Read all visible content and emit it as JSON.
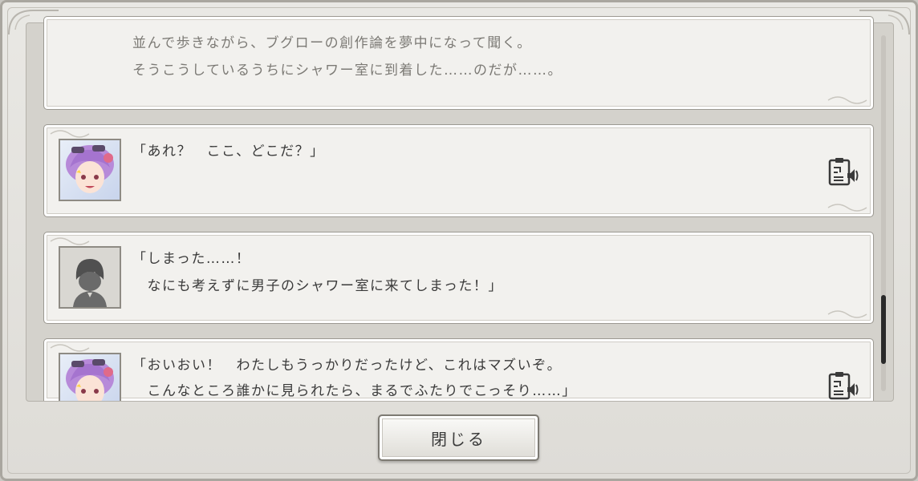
{
  "log": {
    "entries": [
      {
        "type": "narration",
        "lines": [
          "並んで歩きながら、ブグローの創作論を夢中になって聞く。",
          "そうこうしているうちにシャワー室に到着した……のだが……。"
        ]
      },
      {
        "type": "dialogue",
        "speaker_avatar": "purple-hair-girl-avatar",
        "lines": [
          "「あれ？　ここ、どこだ？」"
        ],
        "has_voice": true
      },
      {
        "type": "dialogue",
        "speaker_avatar": "player-silhouette-avatar",
        "lines": [
          "「しまった……！",
          "　なにも考えずに男子のシャワー室に来てしまった！」"
        ],
        "has_voice": false
      },
      {
        "type": "dialogue",
        "speaker_avatar": "purple-hair-girl-avatar",
        "lines": [
          "「おいおい！　わたしもうっかりだったけど、これはマズいぞ。",
          "　こんなところ誰かに見られたら、まるでふたりでこっそり……」"
        ],
        "has_voice": true
      }
    ]
  },
  "close_button": {
    "label": "閉じる"
  },
  "colors": {
    "panel_bg": "#f2f1ee",
    "narration_text": "#7c7a75",
    "dialogue_text": "#3a3a3a",
    "frame": "#9c9992"
  }
}
